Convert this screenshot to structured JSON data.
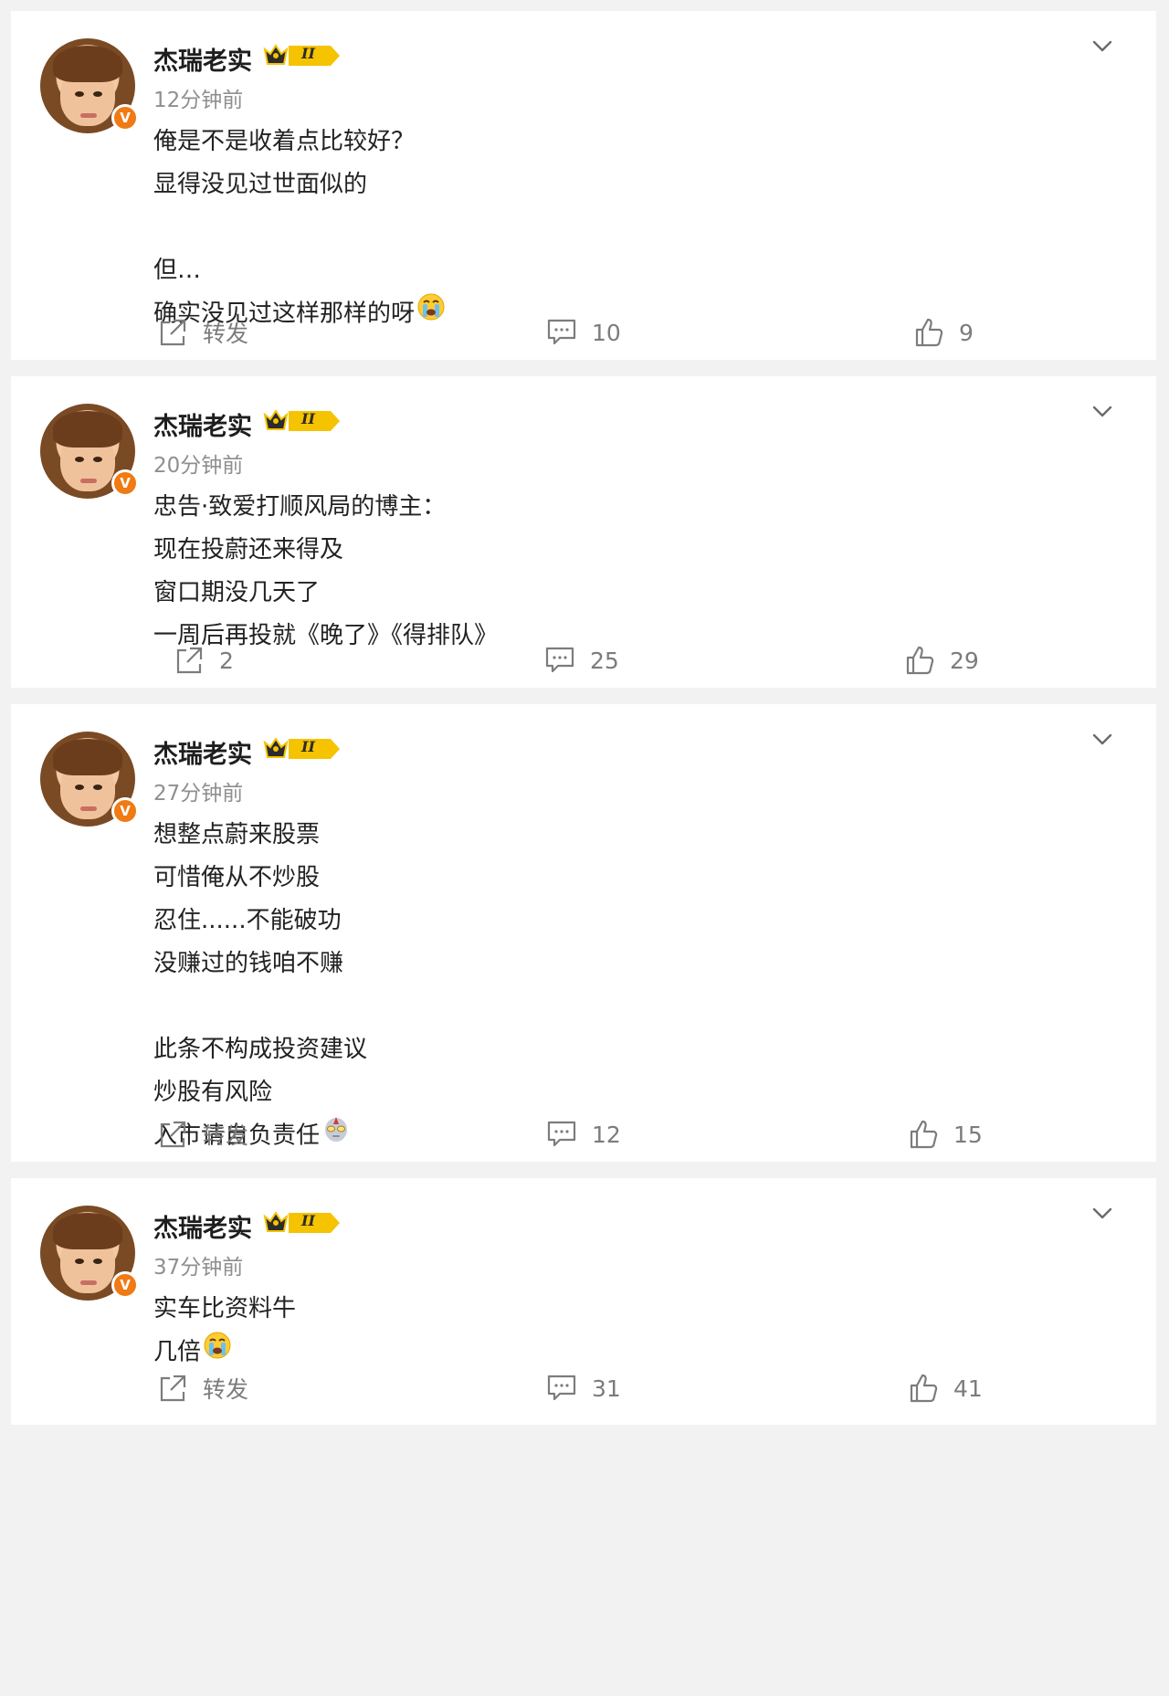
{
  "posts": [
    {
      "username": "杰瑞老实",
      "time": "12分钟前",
      "lines": [
        "俺是不是收着点比较好？",
        "显得没见过世面似的",
        "",
        "但…",
        "确实没见过这样那样的呀"
      ],
      "emoji": "crying-face",
      "repost": "转发",
      "comments": "10",
      "likes": "9"
    },
    {
      "username": "杰瑞老实",
      "time": "20分钟前",
      "lines": [
        "忠告·致爱打顺风局的博主：",
        "现在投蔚还来得及",
        "窗口期没几天了",
        "一周后再投就《晚了》《得排队》"
      ],
      "emoji": "",
      "repost": "2",
      "comments": "25",
      "likes": "29"
    },
    {
      "username": "杰瑞老实",
      "time": "27分钟前",
      "lines": [
        "想整点蔚来股票",
        "可惜俺从不炒股",
        "忍住......不能破功",
        "没赚过的钱咱不赚",
        "",
        "此条不构成投资建议",
        "炒股有风险",
        "入市请自负责任"
      ],
      "emoji": "ultraman",
      "repost": "转发",
      "comments": "12",
      "likes": "15"
    },
    {
      "username": "杰瑞老实",
      "time": "37分钟前",
      "lines": [
        "实车比资料牛",
        "几倍"
      ],
      "emoji": "crying-face",
      "repost": "转发",
      "comments": "31",
      "likes": "41"
    }
  ],
  "icons": {
    "repost": "share-arrow-icon",
    "comment": "comment-bubble-icon",
    "like": "thumbs-up-icon",
    "more": "chevron-down-icon",
    "verified": "verified-v-icon",
    "rank": "crown-badge-icon"
  },
  "verified_label": "V",
  "rank_label": "II",
  "colors": {
    "verified": "#f07a13",
    "rank": "#f5c300",
    "text": "#222222",
    "meta": "#8f8f8f"
  }
}
